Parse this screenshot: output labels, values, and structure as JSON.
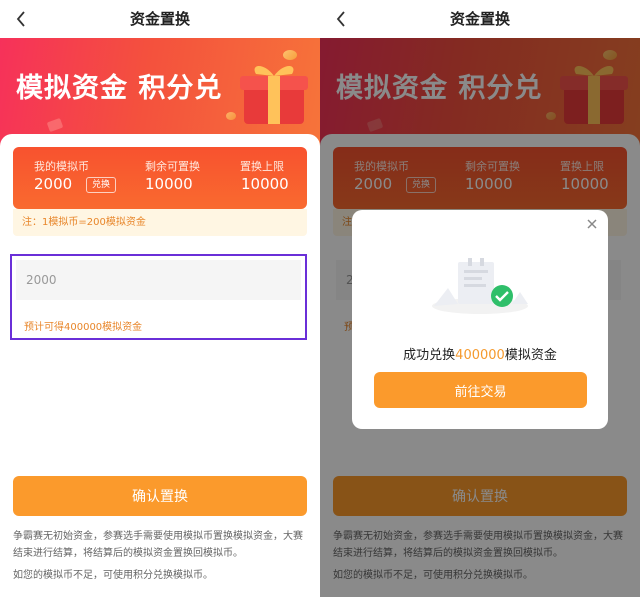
{
  "nav": {
    "title": "资金置换"
  },
  "banner": {
    "headline": "模拟资金 积分兑"
  },
  "card": {
    "my_coins_label": "我的模拟币",
    "my_coins_value": "2000",
    "redeem_chip": "兑换",
    "remaining_label": "剩余可置换",
    "remaining_value": "10000",
    "limit_label": "置换上限",
    "limit_value": "10000"
  },
  "note": "注：1模拟币=200模拟资金",
  "input": {
    "value": "2000"
  },
  "estimate": "预计可得400000模拟资金",
  "confirm_label": "确认置换",
  "description": [
    "争霸赛无初始资金，参赛选手需要使用模拟币置换模拟资金，大赛结束进行结算，将结算后的模拟资金置换回模拟币。",
    "如您的模拟币不足，可使用积分兑换模拟币。"
  ],
  "modal": {
    "message_prefix": "成功兑换",
    "message_amount": "400000",
    "message_suffix": "模拟资金",
    "button_label": "前往交易"
  },
  "colors": {
    "accent_orange": "#fb9a2c",
    "card_red": "#f8522f",
    "highlight_border": "#6a2fd8",
    "success_green": "#2fbf6a"
  }
}
